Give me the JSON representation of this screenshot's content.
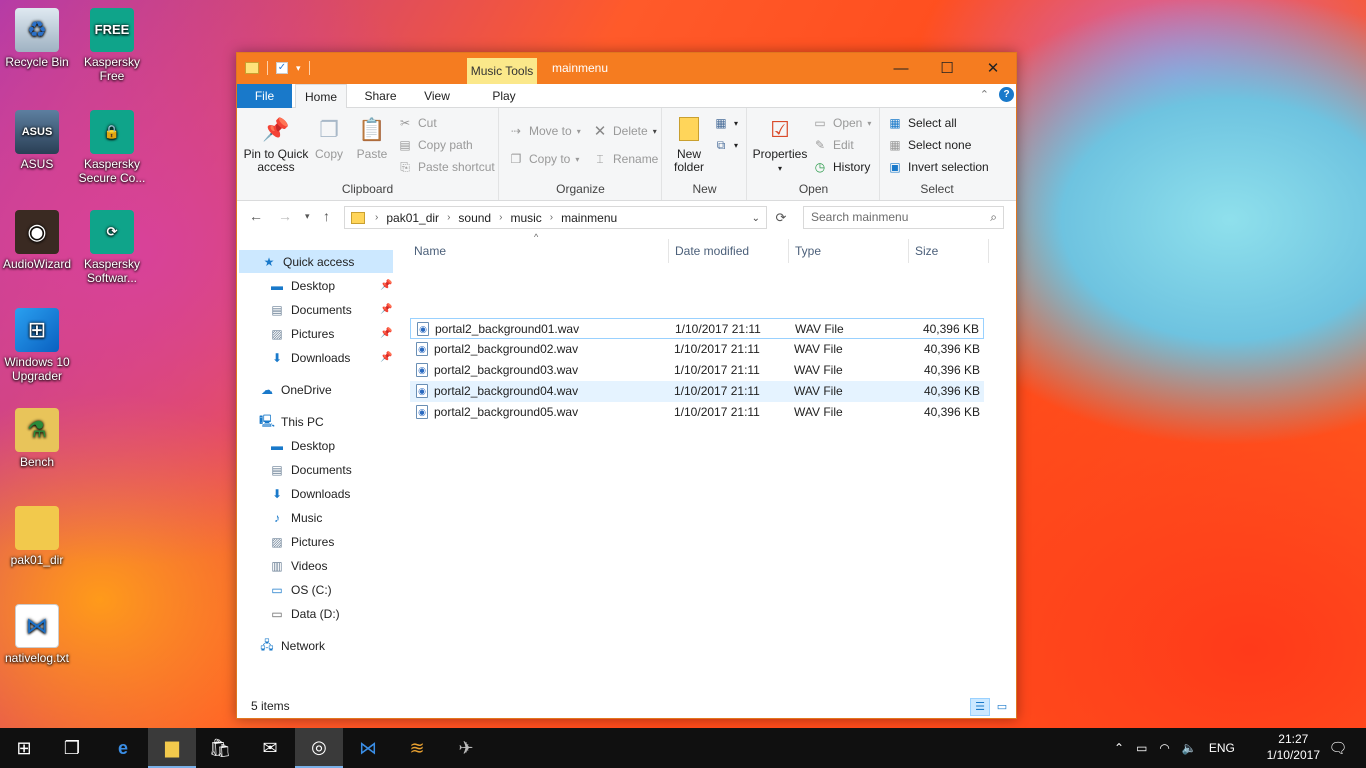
{
  "desktop": {
    "icons": [
      {
        "label": "Recycle Bin",
        "icon": "recycle-bin-icon"
      },
      {
        "label": "Kaspersky Free",
        "icon": "kaspersky-free-icon",
        "badge": "FREE"
      },
      {
        "label": "ASUS",
        "icon": "asus-icon",
        "badge": "ASUS"
      },
      {
        "label": "Kaspersky Secure Co...",
        "icon": "kaspersky-secure-icon"
      },
      {
        "label": "AudioWizard",
        "icon": "audiowizard-icon"
      },
      {
        "label": "Kaspersky Softwar...",
        "icon": "kaspersky-software-icon"
      },
      {
        "label": "Windows 10 Upgrader",
        "icon": "windows-upgrader-icon"
      },
      {
        "label": "Bench",
        "icon": "bench-icon"
      },
      {
        "label": "pak01_dir",
        "icon": "folder-icon"
      },
      {
        "label": "nativelog.txt",
        "icon": "vscode-file-icon"
      }
    ]
  },
  "window": {
    "context_tab": "Music Tools",
    "title": "mainmenu",
    "tabs": {
      "file": "File",
      "home": "Home",
      "share": "Share",
      "view": "View",
      "play": "Play"
    },
    "ribbon": {
      "clipboard": {
        "label": "Clipboard",
        "pin": "Pin to Quick access",
        "copy": "Copy",
        "paste": "Paste",
        "cut": "Cut",
        "copy_path": "Copy path",
        "paste_shortcut": "Paste shortcut"
      },
      "organize": {
        "label": "Organize",
        "move_to": "Move to",
        "copy_to": "Copy to",
        "delete": "Delete",
        "rename": "Rename"
      },
      "new": {
        "label": "New",
        "new_folder": "New folder"
      },
      "open": {
        "label": "Open",
        "properties": "Properties",
        "open": "Open",
        "edit": "Edit",
        "history": "History"
      },
      "select": {
        "label": "Select",
        "select_all": "Select all",
        "select_none": "Select none",
        "invert": "Invert selection"
      }
    },
    "address": {
      "crumbs": [
        "pak01_dir",
        "sound",
        "music",
        "mainmenu"
      ],
      "search_placeholder": "Search mainmenu"
    },
    "nav": {
      "quick_access": "Quick access",
      "qa_items": [
        "Desktop",
        "Documents",
        "Pictures",
        "Downloads"
      ],
      "onedrive": "OneDrive",
      "this_pc": "This PC",
      "pc_items": [
        "Desktop",
        "Documents",
        "Downloads",
        "Music",
        "Pictures",
        "Videos",
        "OS (C:)",
        "Data (D:)"
      ],
      "network": "Network"
    },
    "columns": {
      "name": "Name",
      "date": "Date modified",
      "type": "Type",
      "size": "Size"
    },
    "files": [
      {
        "name": "portal2_background01.wav",
        "date": "1/10/2017 21:11",
        "type": "WAV File",
        "size": "40,396 KB"
      },
      {
        "name": "portal2_background02.wav",
        "date": "1/10/2017 21:11",
        "type": "WAV File",
        "size": "40,396 KB"
      },
      {
        "name": "portal2_background03.wav",
        "date": "1/10/2017 21:11",
        "type": "WAV File",
        "size": "40,396 KB"
      },
      {
        "name": "portal2_background04.wav",
        "date": "1/10/2017 21:11",
        "type": "WAV File",
        "size": "40,396 KB"
      },
      {
        "name": "portal2_background05.wav",
        "date": "1/10/2017 21:11",
        "type": "WAV File",
        "size": "40,396 KB"
      }
    ],
    "status": "5 items"
  },
  "taskbar": {
    "lang": "ENG",
    "time": "21:27",
    "date": "1/10/2017"
  },
  "colors": {
    "accent": "#f57c20",
    "file_tab": "#1979ca",
    "selection": "#cce8ff",
    "context_tab": "#fbe88a"
  }
}
